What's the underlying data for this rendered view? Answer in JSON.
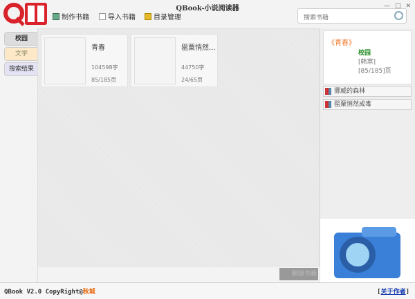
{
  "app": {
    "title": "QBook-小说阅读器",
    "logo_text": "QW"
  },
  "toolbar": {
    "make": "制作书籍",
    "import": "导入书籍",
    "catalog": "目录管理"
  },
  "search": {
    "placeholder": "搜索书籍"
  },
  "tabs": [
    "校园",
    "文学",
    "搜索结果"
  ],
  "books": [
    {
      "title": "青春",
      "words": "104598字",
      "pages": "85/185页"
    },
    {
      "title": "罂粟悄然...",
      "words": "44750字",
      "pages": "24/65页"
    }
  ],
  "info": {
    "title": "《青春》",
    "category": "校园",
    "author": "[韩寒]",
    "progress": "[85/185]页"
  },
  "recent": [
    "挪威的森林",
    "罂粟悄然成毒"
  ],
  "delete_label": "删除书籍",
  "footer": {
    "copyright": "QBook V2.0 CopyRight@",
    "author": "秋城",
    "about_open": "[",
    "about": "关于作者",
    "about_close": "]"
  }
}
